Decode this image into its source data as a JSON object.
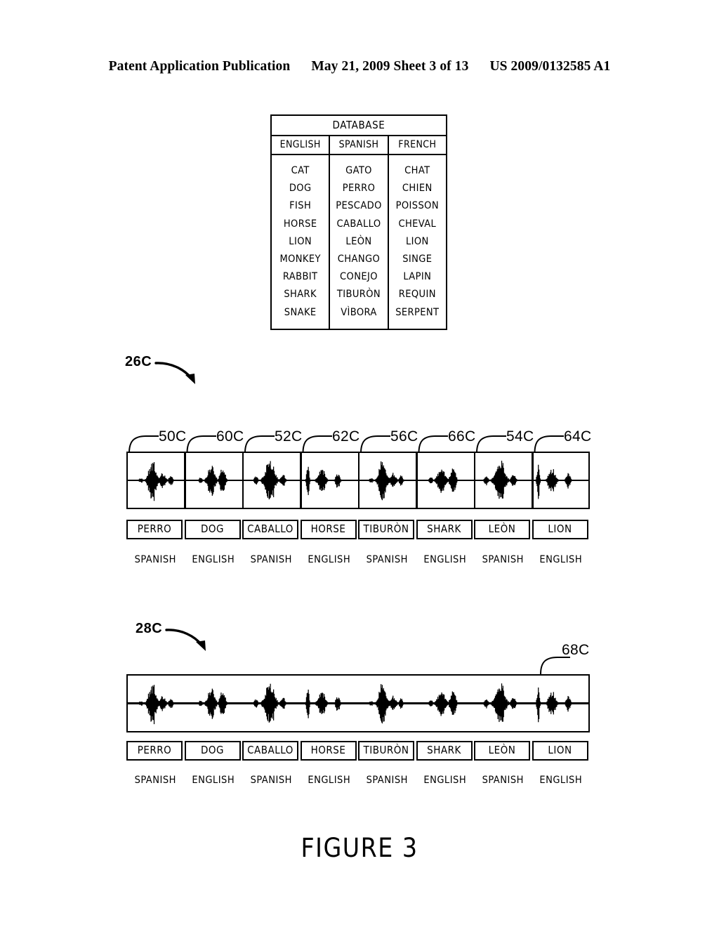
{
  "header": {
    "publication": "Patent Application Publication",
    "date_sheet": "May 21, 2009  Sheet 3 of 13",
    "patent_number": "US 2009/0132585 A1"
  },
  "database": {
    "title": "DATABASE",
    "columns": [
      "ENGLISH",
      "SPANISH",
      "FRENCH"
    ],
    "rows": [
      [
        "CAT",
        "GATO",
        "CHAT"
      ],
      [
        "DOG",
        "PERRO",
        "CHIEN"
      ],
      [
        "FISH",
        "PESCADO",
        "POISSON"
      ],
      [
        "HORSE",
        "CABALLO",
        "CHEVAL"
      ],
      [
        "LION",
        "LEÒN",
        "LION"
      ],
      [
        "MONKEY",
        "CHANGO",
        "SINGE"
      ],
      [
        "RABBIT",
        "CONEJO",
        "LAPIN"
      ],
      [
        "SHARK",
        "TIBURÒN",
        "REQUIN"
      ],
      [
        "SNAKE",
        "VÌBORA",
        "SERPENT"
      ]
    ]
  },
  "segmented_waveform": {
    "callout": "26C",
    "leader_numbers": [
      "50C",
      "60C",
      "52C",
      "62C",
      "56C",
      "66C",
      "54C",
      "64C"
    ],
    "words": [
      "PERRO",
      "DOG",
      "CABALLO",
      "HORSE",
      "TIBURÒN",
      "SHARK",
      "LEÒN",
      "LION"
    ],
    "languages": [
      "SPANISH",
      "ENGLISH",
      "SPANISH",
      "ENGLISH",
      "SPANISH",
      "ENGLISH",
      "SPANISH",
      "ENGLISH"
    ]
  },
  "continuous_waveform": {
    "callout": "28C",
    "leader_numbers": [
      "68C"
    ],
    "words": [
      "PERRO",
      "DOG",
      "CABALLO",
      "HORSE",
      "TIBURÒN",
      "SHARK",
      "LEÒN",
      "LION"
    ],
    "languages": [
      "SPANISH",
      "ENGLISH",
      "SPANISH",
      "ENGLISH",
      "SPANISH",
      "ENGLISH",
      "SPANISH",
      "ENGLISH"
    ]
  },
  "figure_caption": "FIGURE 3",
  "colors": {
    "ink": "#000000",
    "paper": "#ffffff"
  }
}
